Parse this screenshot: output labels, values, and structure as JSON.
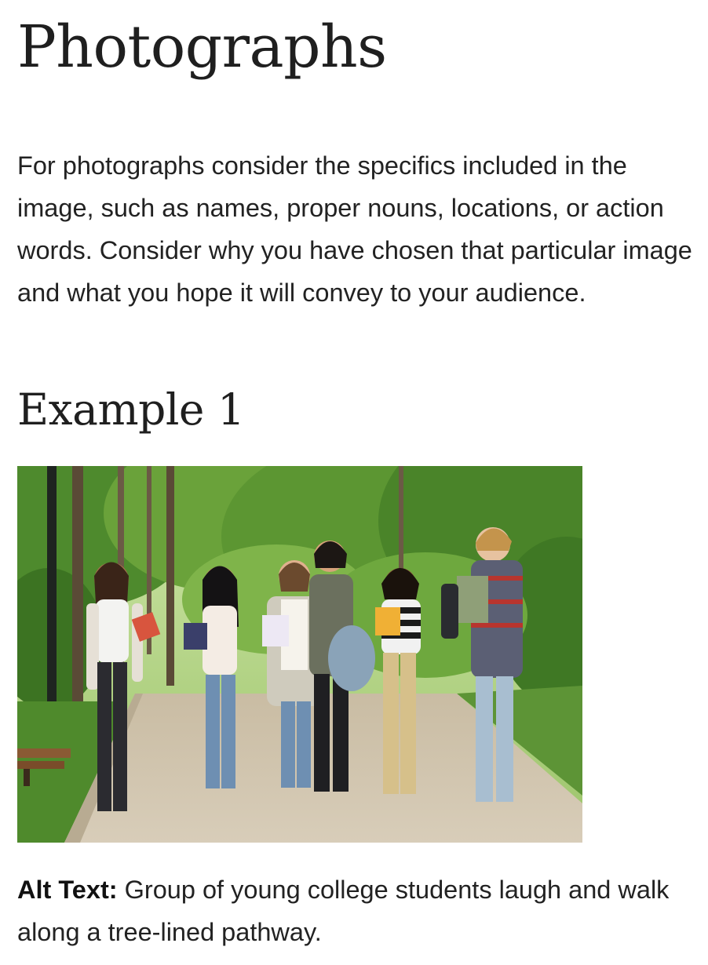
{
  "heading": "Photographs",
  "intro_text": "For photographs consider the specifics included in the image, such as names, proper nouns, locations, or action words. Consider why you have chosen that particular image and what you hope it will convey to your audience.",
  "example": {
    "title": "Example 1",
    "image": {
      "alt_label": "Alt Text:",
      "alt_text": "Group of young college students laugh and walk along a tree-lined pathway."
    }
  }
}
